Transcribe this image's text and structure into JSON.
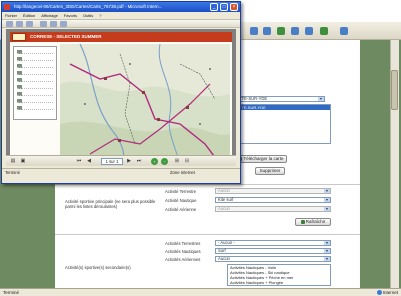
{
  "pdf_window": {
    "title": "http://langeovi-06/Cartes_3DE/Cartes/Carte_76738.pdf - Microsoft Intern...",
    "menu": [
      "Fichier",
      "Édition",
      "Affichage",
      "Favoris",
      "Outils",
      "?"
    ],
    "map_header": "CORRESE - SELECTED SUMMER",
    "page_indicator": "1 sur 1",
    "status_left": "Terminé",
    "status_zone": "Zone Internet",
    "title_buttons": [
      "_",
      "□",
      "×"
    ]
  },
  "form": {
    "list_header_value": "HTTE-SUR-YDE",
    "list_items": [
      "HTTE-SUR-YDE",
      "",
      "",
      "",
      "",
      "",
      ""
    ],
    "buttons": {
      "download_map": "Télécharger la carte",
      "delete": "Supprimer",
      "refresh": "Rafraîchir"
    },
    "section_principal": {
      "label": "Activité sportive principale (ne sera plus possible parmi les listes déroulantes)",
      "rows": [
        {
          "label": "Activité Terrestre",
          "value": "Aucun",
          "disabled": true
        },
        {
          "label": "Activité Nautique",
          "value": "Kite surf",
          "disabled": false
        },
        {
          "label": "Activité Aérienne",
          "value": "Aucun",
          "disabled": true
        }
      ]
    },
    "section_secondary": {
      "label": "Activité(s) sportive(s) secondaire(s)",
      "rows": [
        {
          "label": "Activités Terrestres",
          "value": "- Aucun -"
        },
        {
          "label": "Activités Nautiques",
          "value": "Surf"
        },
        {
          "label": "Activités Aériennes",
          "value": "Aucun"
        }
      ],
      "nautical_list": [
        "Activités Nautiques - Voile",
        "Activités Nautiques - Ski nautique",
        "Activités Nautiques + Pêche en mer",
        "Activités Nautiques + Plongée"
      ]
    }
  },
  "statusbar": {
    "left": "Terminé",
    "right": "Internet"
  },
  "colors": {
    "titlebar": "#1b4fc4",
    "map_header": "#c43c1c",
    "selection": "#316ac5",
    "desktop": "#5f7a52"
  }
}
